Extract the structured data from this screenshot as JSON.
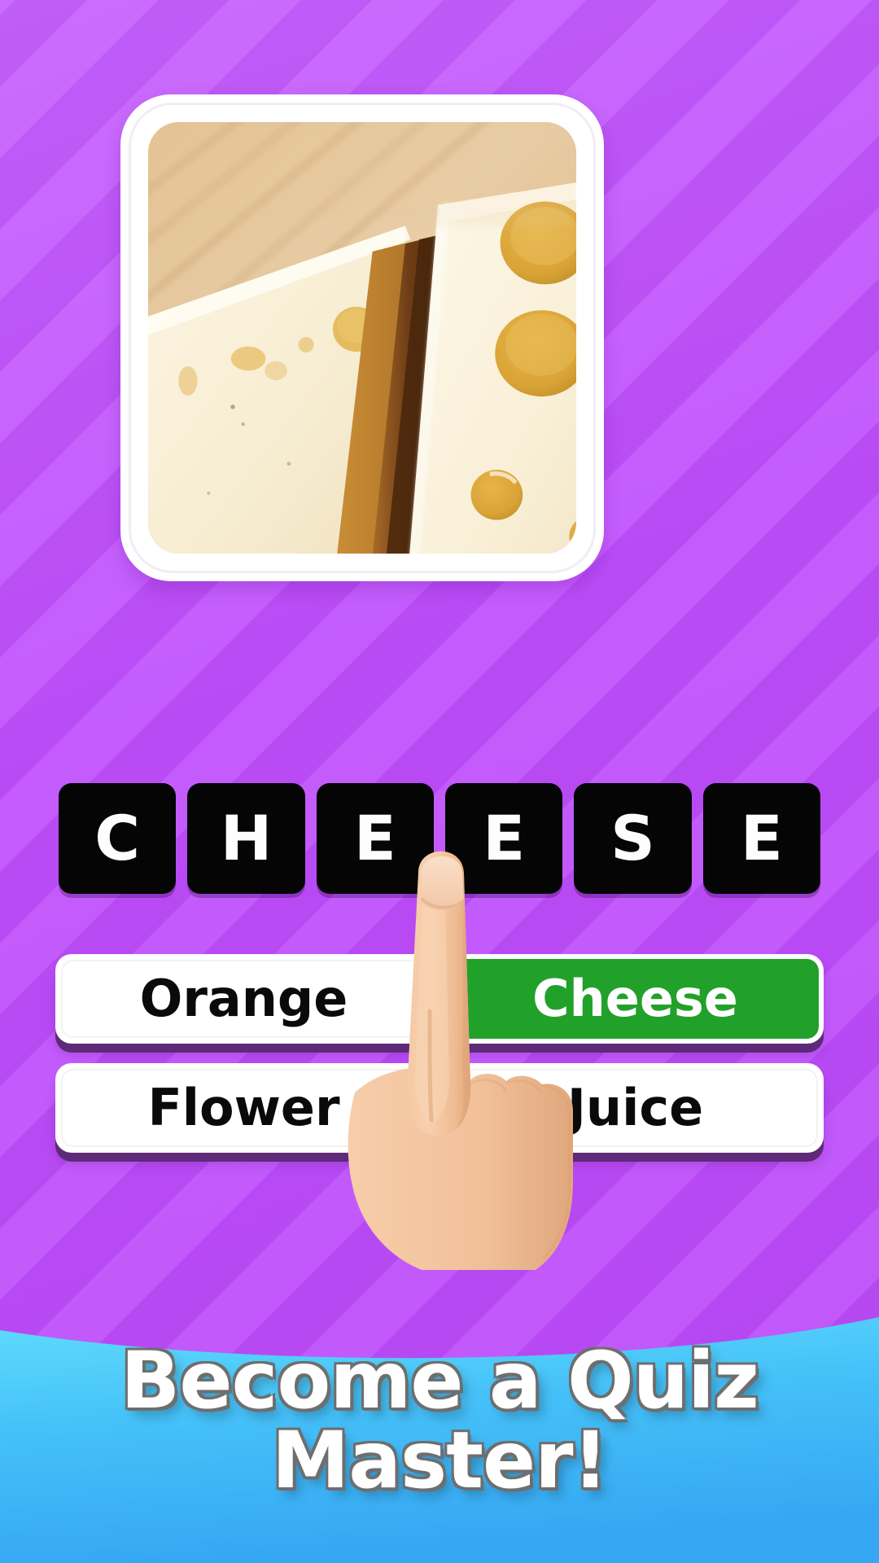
{
  "theme": {
    "bg_purple_light": "#c45cfd",
    "bg_purple_dark": "#b94bf5",
    "correct_green": "#22a12a",
    "tile_black": "#050505",
    "button_white": "#ffffff",
    "button_shadow_purple": "#5e2a78",
    "banner_blue_light": "#59d8fb",
    "banner_blue_dark": "#37a8f5",
    "text_white": "#ffffff",
    "text_black": "#0a0a0a"
  },
  "puzzle": {
    "image_alt": "close-up photo of two blocks of swiss cheese with holes on a wooden board",
    "answer_word": "CHEESE",
    "letters": [
      "C",
      "H",
      "E",
      "E",
      "S",
      "E"
    ]
  },
  "answers": [
    {
      "label": "Orange",
      "state": "default"
    },
    {
      "label": "Cheese",
      "state": "correct"
    },
    {
      "label": "Flower",
      "state": "default"
    },
    {
      "label": "Juice",
      "state": "default"
    }
  ],
  "cursor": {
    "icon": "pointing-hand-icon",
    "target": "Cheese"
  },
  "banner": {
    "line1": "Become a Quiz",
    "line2": "Master!"
  }
}
